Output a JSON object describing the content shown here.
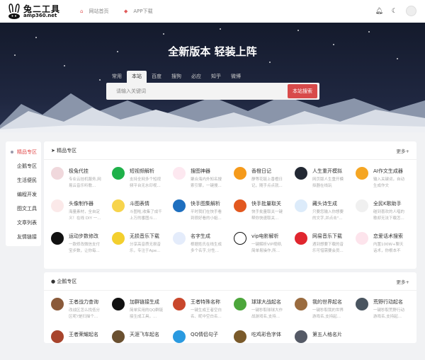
{
  "header": {
    "logo_title": "兔二工具",
    "logo_sub": "amp360.net",
    "nav": [
      {
        "label": "网站首页",
        "icon": "home-icon"
      },
      {
        "label": "APP下载",
        "icon": "download-icon"
      }
    ],
    "icons": [
      "bell-icon",
      "moon-icon",
      "avatar"
    ]
  },
  "banner": {
    "title": "全新版本 轻装上阵",
    "tabs": [
      "常用",
      "本站",
      "百度",
      "搜狗",
      "必应",
      "知乎",
      "微博"
    ],
    "active_tab": "本站",
    "search_placeholder": "请输入关键词",
    "search_button": "本站搜索"
  },
  "sidebar": {
    "items": [
      "精品专区",
      "企鹅专区",
      "生活便民",
      "编程开发",
      "图文工具",
      "文章列表",
      "友情链接"
    ],
    "active": "精品专区"
  },
  "sections": [
    {
      "title": "精品专区",
      "icon": "send-icon",
      "more": "更多+",
      "items": [
        {
          "name": "极兔代挂",
          "desc": "专业云挂机服务,网易云音乐听歌...",
          "color": "#f0d8dc"
        },
        {
          "name": "短视频解析",
          "desc": "支持全网多个短视频平台无水印视...",
          "color": "#1fb14a"
        },
        {
          "name": "搜图神器",
          "desc": "聚合海内外知名搜索引擎，一键搜...",
          "color": "#fde8f0"
        },
        {
          "name": "香橙日记",
          "desc": "静等花链上香橙日记，随手点点就...",
          "color": "#f59a1b"
        },
        {
          "name": "人生重开模拟",
          "desc": "网页版人生重开模拟器在线玩",
          "color": "#222833"
        },
        {
          "name": "AI作文生成器",
          "desc": "输入关键词，自动生成作文",
          "color": "#f5a623"
        },
        {
          "name": "头像制作器",
          "desc": "海量素材，全自定义！在线 DIY 一...",
          "color": "#fbe9e9"
        },
        {
          "name": "斗图表情",
          "desc": "斗图啦,收集了成千上万的番图斗...",
          "color": "#f7d44c"
        },
        {
          "name": "快手图集解析",
          "desc": "平时我们在快手看到很好看的小姐...",
          "color": "#1e6fbf"
        },
        {
          "name": "快手批量取关",
          "desc": "快手批量取关一键帮你快速取关...",
          "color": "#e2581f"
        },
        {
          "name": "藏头诗生成",
          "desc": "只要您输入你想要的文字,并点击\"...",
          "color": "#dcebfa"
        },
        {
          "name": "全民K歌助手",
          "desc": "碰到喜欢的人唱的歌却无法下载怎...",
          "color": "#f0f0f0"
        },
        {
          "name": "运动步数修改",
          "desc": "一款修改微信支付宝步数，让你每...",
          "color": "#111"
        },
        {
          "name": "无损音乐下载",
          "desc": "分享高音质无损音乐，专注于Ape...",
          "color": "#f3cf2e"
        },
        {
          "name": "名字生成",
          "desc": "根据姓氏在线生成多个名字,分性...",
          "color": "#e4ecfb"
        },
        {
          "name": "vip电影解析",
          "desc": "一键解析VIP视频,简单易操作,所...",
          "color": "#fff"
        },
        {
          "name": "网易音乐下载",
          "desc": "遇到想要下载的音乐可惜需要会员...",
          "color": "#e0262e"
        },
        {
          "name": "恋爱话术搜索",
          "desc": "内置100W+聊天话术，你根本不需...",
          "color": "#fde4ec"
        }
      ]
    },
    {
      "title": "企鹅专区",
      "icon": "penguin-icon",
      "more": "更多+",
      "items": [
        {
          "name": "王者战力查询",
          "desc": "改战区怎么找低分区呢?是扫描个...",
          "color": "#8a5a3a"
        },
        {
          "name": "加群链接生成",
          "desc": "简单实用的QQ群链接生成工具，...",
          "color": "#111"
        },
        {
          "name": "王者特殊名称",
          "desc": "一键生成王者空白名、昵中空白名...",
          "color": "#c9472c"
        },
        {
          "name": "球球大战起名",
          "desc": "一键秒取球球大作战游戏名,支持...",
          "color": "#4ca63b"
        },
        {
          "name": "我的世界起名",
          "desc": "一键秒取我的世界游戏名,支持起...",
          "color": "#9a6b3f"
        },
        {
          "name": "荒野行动起名",
          "desc": "一键秒取荒野行动游戏名,支持起...",
          "color": "#4a5560"
        },
        {
          "name": "王者荣耀起名",
          "desc": "",
          "color": "#a8442c"
        },
        {
          "name": "天涯飞车起名",
          "desc": "",
          "color": "#6a5030"
        },
        {
          "name": "QQ情侣句子",
          "desc": "",
          "color": "#2a9ae0"
        },
        {
          "name": "吃鸡彩色字体",
          "desc": "",
          "color": "#7a5a2a"
        },
        {
          "name": "第五人格名片",
          "desc": "",
          "color": "#555a66"
        }
      ]
    }
  ]
}
